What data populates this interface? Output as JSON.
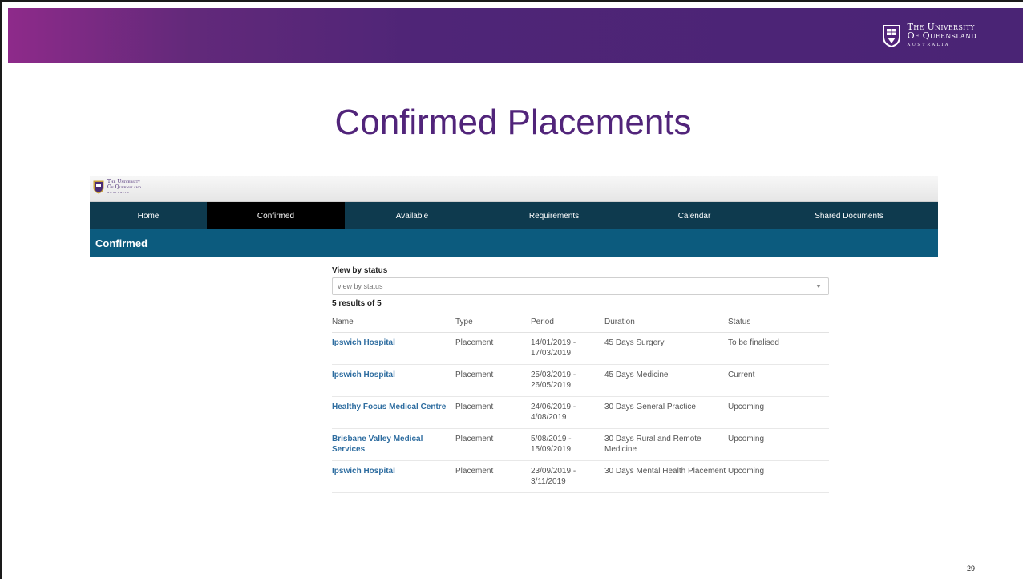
{
  "banner": {
    "logo_line1": "The University",
    "logo_line2": "Of Queensland",
    "logo_line3": "AUSTRALIA"
  },
  "slide": {
    "title": "Confirmed Placements",
    "page_number": "29"
  },
  "app": {
    "logo_line1": "The University",
    "logo_line2": "Of Queensland",
    "logo_line3": "AUSTRALIA",
    "nav": [
      {
        "label": "Home",
        "active": false
      },
      {
        "label": "Confirmed",
        "active": true
      },
      {
        "label": "Available",
        "active": false
      },
      {
        "label": "Requirements",
        "active": false
      },
      {
        "label": "Calendar",
        "active": false
      },
      {
        "label": "Shared Documents",
        "active": false
      }
    ],
    "section_title": "Confirmed",
    "filter": {
      "label": "View by status",
      "placeholder": "view by status"
    },
    "results_text": "5 results of 5",
    "table": {
      "headers": [
        "Name",
        "Type",
        "Period",
        "Duration",
        "Status"
      ],
      "rows": [
        {
          "name": "Ipswich Hospital",
          "type": "Placement",
          "period_start": "14/01/2019 -",
          "period_end": "17/03/2019",
          "duration": "45 Days Surgery",
          "status": "To be finalised"
        },
        {
          "name": "Ipswich Hospital",
          "type": "Placement",
          "period_start": "25/03/2019 -",
          "period_end": "26/05/2019",
          "duration": "45 Days Medicine",
          "status": "Current"
        },
        {
          "name": "Healthy Focus Medical Centre",
          "type": "Placement",
          "period_start": "24/06/2019 -",
          "period_end": "4/08/2019",
          "duration": "30 Days General Practice",
          "status": "Upcoming"
        },
        {
          "name": "Brisbane Valley Medical Services",
          "type": "Placement",
          "period_start": "5/08/2019 -",
          "period_end": "15/09/2019",
          "duration": "30 Days Rural and Remote Medicine",
          "status": "Upcoming"
        },
        {
          "name": "Ipswich Hospital",
          "type": "Placement",
          "period_start": "23/09/2019 -",
          "period_end": "3/11/2019",
          "duration": "30 Days Mental Health Placement",
          "status": "Upcoming"
        }
      ]
    }
  },
  "colors": {
    "brand_purple": "#51247a",
    "nav_bg": "#0e3a4e",
    "section_bg": "#0c5b7e",
    "link_blue": "#2e6da0"
  }
}
